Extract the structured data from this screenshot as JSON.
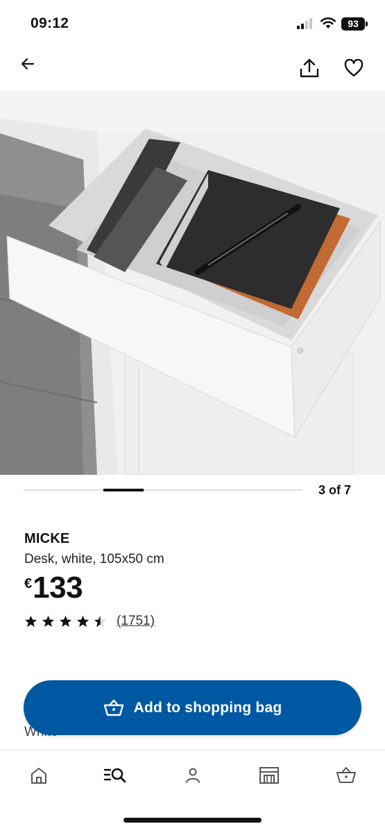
{
  "status_bar": {
    "time": "09:12",
    "battery": "93"
  },
  "pager": {
    "counter": "3 of 7",
    "current": 3,
    "total": 7
  },
  "product": {
    "name": "MICKE",
    "description": "Desk, white, 105x50 cm",
    "currency": "€",
    "price": "133",
    "rating": 4.5,
    "review_count": "(1751)"
  },
  "variant_label": "White",
  "cta": {
    "add_to_bag_label": "Add to shopping bag"
  },
  "colors": {
    "brand_blue": "#0058a3",
    "text": "#111111"
  },
  "icons": {
    "header": [
      "back-arrow-icon",
      "share-icon",
      "heart-icon"
    ],
    "bottom_nav": [
      "home-icon",
      "search-icon",
      "profile-icon",
      "store-icon",
      "shopping-bag-icon"
    ]
  }
}
